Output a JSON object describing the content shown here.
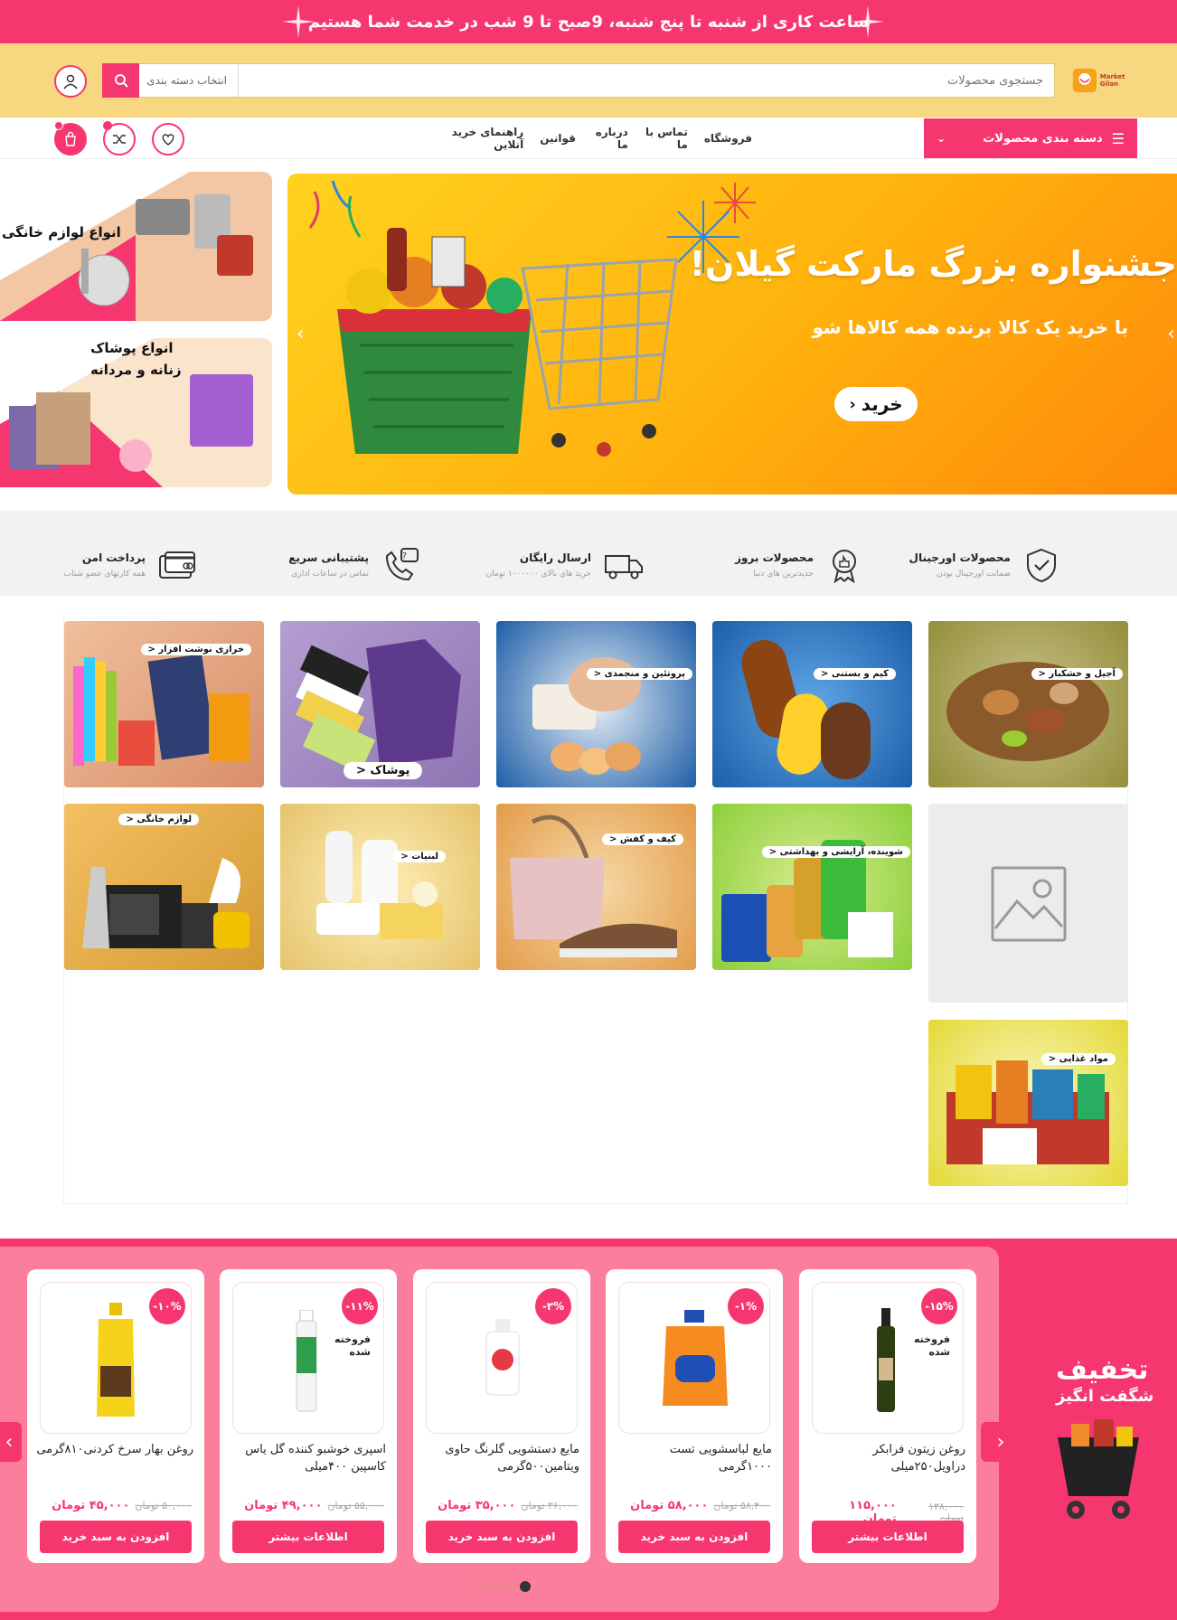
{
  "topbar": {
    "text": "ساعت کاری از شنبه تا پنج شنبه، 9صبح تا 9 شب در خدمت شما هستیم"
  },
  "header": {
    "logo_text": "Market Gilan",
    "search_placeholder": "جستجوی محصولات",
    "category_select": "انتخاب دسته بندی"
  },
  "nav": {
    "categories_button": "دسته بندی محصولات",
    "links": [
      "فروشگاه",
      "تماس با ما",
      "درباره ما",
      "قوانین",
      "راهنمای خرید آنلاین"
    ],
    "cart_count": "0",
    "compare_count": "0"
  },
  "hero": {
    "title": "جشنواره بزرگ مارکت گیلان!",
    "subtitle": "با خرید یک کالا برنده همه کالاها شو",
    "button": "خرید"
  },
  "side_banners": {
    "home_appliances": "انواع لوازم خانگی",
    "clothing_line1": "انواع پوشاک",
    "clothing_line2": "زنانه و مردانه"
  },
  "features": [
    {
      "title": "محصولات اورجینال",
      "sub": "ضمانت اورجینال بودن",
      "icon": "shield-check-icon"
    },
    {
      "title": "محصولات بروز",
      "sub": "جدیدترین های دنیا",
      "icon": "award-icon"
    },
    {
      "title": "ارسال رایگان",
      "sub": "خرید های بالای ۱۰۰۰۰۰۰ تومان",
      "icon": "truck-icon"
    },
    {
      "title": "پشتیبانی سریع",
      "sub": "تماس در ساعات اداری",
      "icon": "support-phone-icon"
    },
    {
      "title": "پرداخت امن",
      "sub": "همه کارتهای عضو شتاب",
      "icon": "credit-card-icon"
    }
  ],
  "categories": {
    "nuts": "آجیل و خشکبار",
    "icecream": "کیم و بستنی",
    "protein": "پروتئین و منجمدی",
    "clothing": "پوشاک",
    "stationery": "خرازی نوشت افزار",
    "placeholder": "",
    "hygiene": "شوینده، آرایشی و بهداشتی",
    "bags": "کیف و کفش",
    "dairy": "لبنیات",
    "appliances": "لوازم خانگی",
    "food": "مواد غذایی"
  },
  "offers": {
    "title_line1": "تخفیف",
    "title_line2": "شگفت انگیز",
    "out_of_stock": "فروخته شده",
    "products": [
      {
        "name": "روغن زیتون فرابکر دراویل۲۵۰میلی",
        "discount": "-۱۵%",
        "old_price": "۱۳۸,۰۰۰ تومان",
        "new_price": "۱۱۵,۰۰۰ تومان",
        "button": "اطلاعات بیشتر",
        "sold_out": true
      },
      {
        "name": "مایع لباسشویی تست ۱۰۰۰گرمی",
        "discount": "-۱%",
        "old_price": "۵۸,۴۰۰ تومان",
        "new_price": "۵۸,۰۰۰ تومان",
        "button": "افزودن به سبد خرید",
        "sold_out": false
      },
      {
        "name": "مایع دستشویی گلرنگ حاوی ویتامین۵۰۰گرمی",
        "discount": "-۳%",
        "old_price": "۳۶,۰۰۰ تومان",
        "new_price": "۳۵,۰۰۰ تومان",
        "button": "افزودن به سبد خرید",
        "sold_out": false
      },
      {
        "name": "اسپری خوشبو کننده گل یاس کاسپین ۴۰۰میلی",
        "discount": "-۱۱%",
        "old_price": "۵۵,۰۰۰ تومان",
        "new_price": "۴۹,۰۰۰ تومان",
        "button": "اطلاعات بیشتر",
        "sold_out": true
      },
      {
        "name": "روغن بهار سرخ کردنی۸۱۰گرمی",
        "discount": "-۱۰%",
        "old_price": "۵۰,۰۰۰ تومان",
        "new_price": "۴۵,۰۰۰ تومان",
        "button": "افزودن به سبد خرید",
        "sold_out": false
      }
    ]
  },
  "colors": {
    "accent": "#f6376f",
    "header_bg": "#f7d780",
    "offers_bg": "#fb7f9c"
  }
}
